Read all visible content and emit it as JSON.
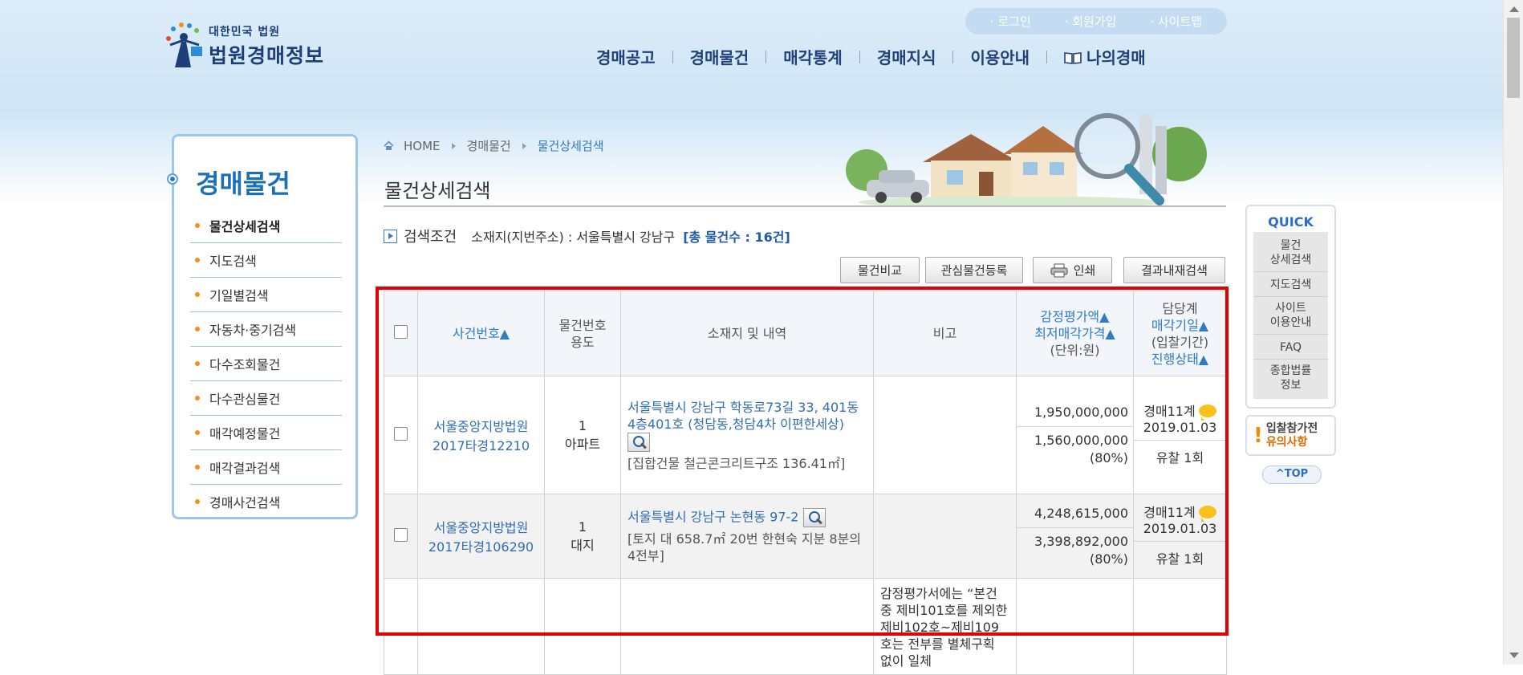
{
  "header": {
    "logo_sub": "대한민국 법원",
    "logo_main": "법원경매정보",
    "top_links": [
      "· 로그인",
      "· 회원가입",
      "· 사이트맵"
    ],
    "gnb": [
      "경매공고",
      "경매물건",
      "매각통계",
      "경매지식",
      "이용안내",
      "나의경매"
    ]
  },
  "sidebar": {
    "title": "경매물건",
    "items": [
      "물건상세검색",
      "지도검색",
      "기일별검색",
      "자동차·중기검색",
      "다수조회물건",
      "다수관심물건",
      "매각예정물건",
      "매각결과검색",
      "경매사건검색"
    ]
  },
  "breadcrumb": [
    "HOME",
    "경매물건",
    "물건상세검색"
  ],
  "page_title": "물건상세검색",
  "search_condition": {
    "label": "검색조건",
    "text": "소재지(지번주소) : 서울특별시 강남구",
    "total": "[총 물건수 : 16건]"
  },
  "buttons": {
    "compare": "물건비교",
    "interest": "관심물건등록",
    "print": "인쇄",
    "result_search": "결과내재검색"
  },
  "table": {
    "headers": {
      "case_no": "사건번호▲",
      "item_no": "물건번호",
      "usage": "용도",
      "location": "소재지 및 내역",
      "remarks": "비고",
      "appraisal": "감정평가액▲",
      "min_price": "최저매각가격▲",
      "unit": "(단위:원)",
      "dept": "담당계",
      "sale_date": "매각기일▲",
      "period": "(입찰기간)",
      "status": "진행상태▲"
    },
    "rows": [
      {
        "court": "서울중앙지방법원",
        "case_no": "2017타경12210",
        "item_no": "1",
        "usage": "아파트",
        "address": "서울특별시 강남구 학동로73길 33, 401동 4층401호 (청담동,청담4차 이편한세상)",
        "detail": "[집합건물 철근콘크리트구조 136.41㎡]",
        "remarks": "",
        "appraisal": "1,950,000,000",
        "min_price": "1,560,000,000",
        "percent": "(80%)",
        "dept": "경매11계",
        "date": "2019.01.03",
        "status": "유찰 1회"
      },
      {
        "court": "서울중앙지방법원",
        "case_no": "2017타경106290",
        "item_no": "1",
        "usage": "대지",
        "address": "서울특별시 강남구 논현동 97-2",
        "detail": "[토지 대 658.7㎡ 20번 한현숙 지분 8분의 4전부]",
        "remarks": "",
        "appraisal": "4,248,615,000",
        "min_price": "3,398,892,000",
        "percent": "(80%)",
        "dept": "경매11계",
        "date": "2019.01.03",
        "status": "유찰 1회"
      },
      {
        "remarks": "감정평가서에는 “본건 중 제비101호를 제외한 제비102호~제비109호는 전부를 별체구획 없이 일체"
      }
    ]
  },
  "quick": {
    "title": "QUICK",
    "items": [
      "물건\n상세검색",
      "지도검색",
      "사이트\n이용안내",
      "FAQ",
      "종합법률\n정보"
    ]
  },
  "notice": {
    "line1": "입찰참가전",
    "line2": "유의사항"
  },
  "top_button": "^TOP",
  "colors": {
    "accent": "#2f7bc4",
    "highlight_border": "#e30000",
    "bullet": "#f29018"
  }
}
